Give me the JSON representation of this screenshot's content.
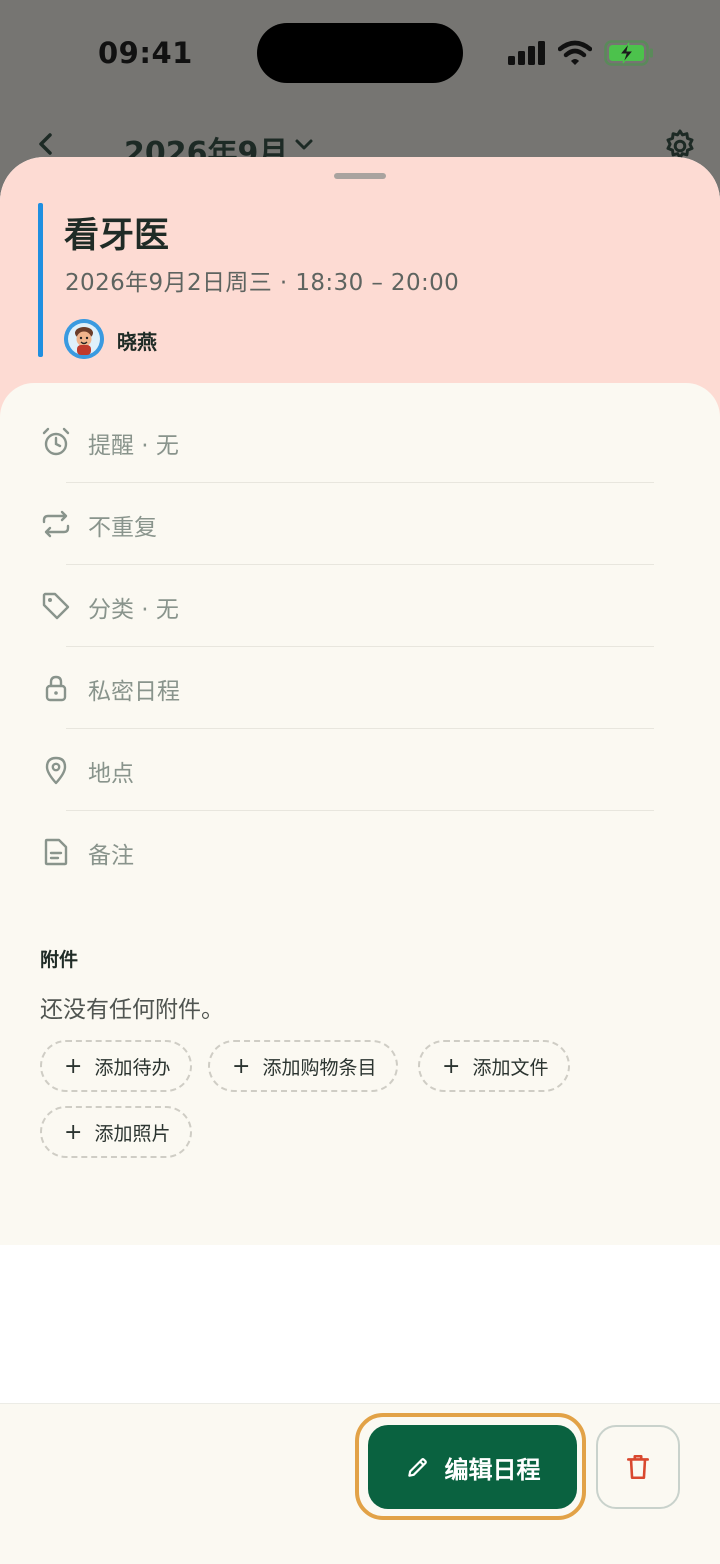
{
  "status_bar": {
    "time": "09:41",
    "icons": [
      "signal-icon",
      "wifi-icon",
      "battery-charging-icon"
    ]
  },
  "background_nav": {
    "month": "2026年9月",
    "icons": [
      "back-chevron-icon",
      "chevron-down-icon",
      "gear-icon"
    ]
  },
  "event": {
    "title": "看牙医",
    "datetime": "2026年9月2日周三 · 18:30 – 20:00",
    "owner": "晓燕",
    "accent_color": "#1f8fe0",
    "header_color": "#fddbd3"
  },
  "details": [
    {
      "icon": "alarm-clock-icon",
      "label": "提醒 · 无"
    },
    {
      "icon": "repeat-icon",
      "label": "不重复"
    },
    {
      "icon": "tag-icon",
      "label": "分类 · 无"
    },
    {
      "icon": "lock-icon",
      "label": "私密日程"
    },
    {
      "icon": "location-pin-icon",
      "label": "地点"
    },
    {
      "icon": "note-icon",
      "label": "备注"
    }
  ],
  "attachments": {
    "title": "附件",
    "empty_text": "还没有任何附件。",
    "actions": [
      {
        "plus": "+",
        "label": "添加待办"
      },
      {
        "plus": "+",
        "label": "添加购物条目"
      },
      {
        "plus": "+",
        "label": "添加文件"
      },
      {
        "plus": "+",
        "label": "添加照片"
      }
    ]
  },
  "footer": {
    "edit_label": "编辑日程",
    "edit_icon": "pencil-icon",
    "delete_icon": "trash-icon",
    "primary_color": "#0a6240",
    "highlight_color": "#e2a247",
    "danger_color": "#d9482f"
  }
}
